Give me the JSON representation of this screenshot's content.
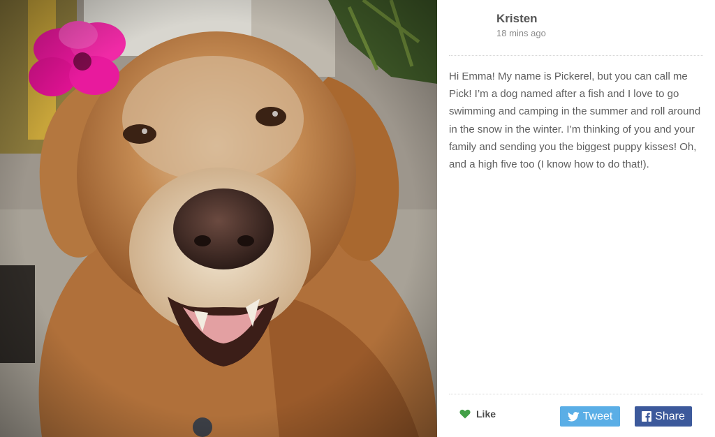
{
  "post": {
    "author_name": "Kristen",
    "timestamp": "18 mins ago",
    "message": "Hi Emma! My name is Pickerel, but you can call me Pick! I’m a dog named after a fish and I love to go swimming and camping in the summer and roll around in the snow in the winter. I’m thinking of you and your family and sending you the biggest puppy kisses! Oh, and a high five too (I know how to do that!)."
  },
  "actions": {
    "like_label": "Like",
    "like_icon": "heart-icon",
    "tweet_label": "Tweet",
    "tweet_icon": "twitter-bird-icon",
    "share_label": "Share",
    "share_icon": "facebook-icon"
  },
  "colors": {
    "like_green": "#43a047",
    "tweet_blue": "#5aaee6",
    "facebook_blue": "#3c599b",
    "flower_pink": "#e8179b"
  }
}
